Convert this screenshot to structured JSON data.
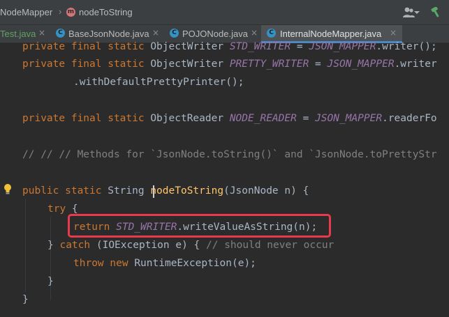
{
  "breadcrumb": {
    "class_name": "NodeMapper",
    "separator": "›",
    "method_badge": "m",
    "method_name": "nodeToString"
  },
  "toolbar_icons": {
    "user": "user-icon",
    "build": "hammer-icon"
  },
  "tabs": [
    {
      "label": "Test.java",
      "close": "×",
      "icon": ""
    },
    {
      "label": "BaseJsonNode.java",
      "close": "×",
      "icon": "C"
    },
    {
      "label": "POJONode.java",
      "close": "×",
      "icon": "C"
    },
    {
      "label": "InternalNodeMapper.java",
      "close": "×",
      "icon": "C",
      "active": true
    }
  ],
  "code": {
    "line1": {
      "kw": "private final static ",
      "type": "ObjectWriter ",
      "name": "STD_WRITER",
      "eq": " = ",
      "ref": "JSON_MAPPER",
      "rest": ".writer();"
    },
    "line2": {
      "kw": "private final static ",
      "type": "ObjectWriter ",
      "name": "PRETTY_WRITER",
      "eq": " = ",
      "ref": "JSON_MAPPER",
      "rest": ".writer"
    },
    "line3": {
      "rest": ".withDefaultPrettyPrinter();"
    },
    "line4": {
      "kw": "private final static ",
      "type": "ObjectReader ",
      "name": "NODE_READER",
      "eq": " = ",
      "ref": "JSON_MAPPER",
      "rest": ".readerFo"
    },
    "line5": {
      "comment": "// // // Methods for `JsonNode.toString()` and `JsonNode.toPrettyStr"
    },
    "line6": {
      "kw": "public static ",
      "type": "String ",
      "method": "nodeToString",
      "rest": "(JsonNode n) {"
    },
    "line7": {
      "kw": "try",
      "rest": " {"
    },
    "line8": {
      "kw": "return ",
      "name": "STD_WRITER",
      "rest": ".writeValueAsString(n);"
    },
    "line9": {
      "pre": "} ",
      "kw": "catch",
      "rest": " (IOException e) { ",
      "comment": "// should never occur"
    },
    "line10": {
      "kw": "throw new ",
      "rest": "RuntimeException(e);"
    },
    "line11": {
      "rest": "}"
    },
    "line12": {
      "rest": "}"
    }
  },
  "colors": {
    "keyword": "#cc7832",
    "static_field": "#9876aa",
    "method_decl": "#ffc66d",
    "comment": "#808080",
    "highlight_box": "#e8394d"
  },
  "gutter_icons": {
    "intention": "lightbulb-icon"
  }
}
